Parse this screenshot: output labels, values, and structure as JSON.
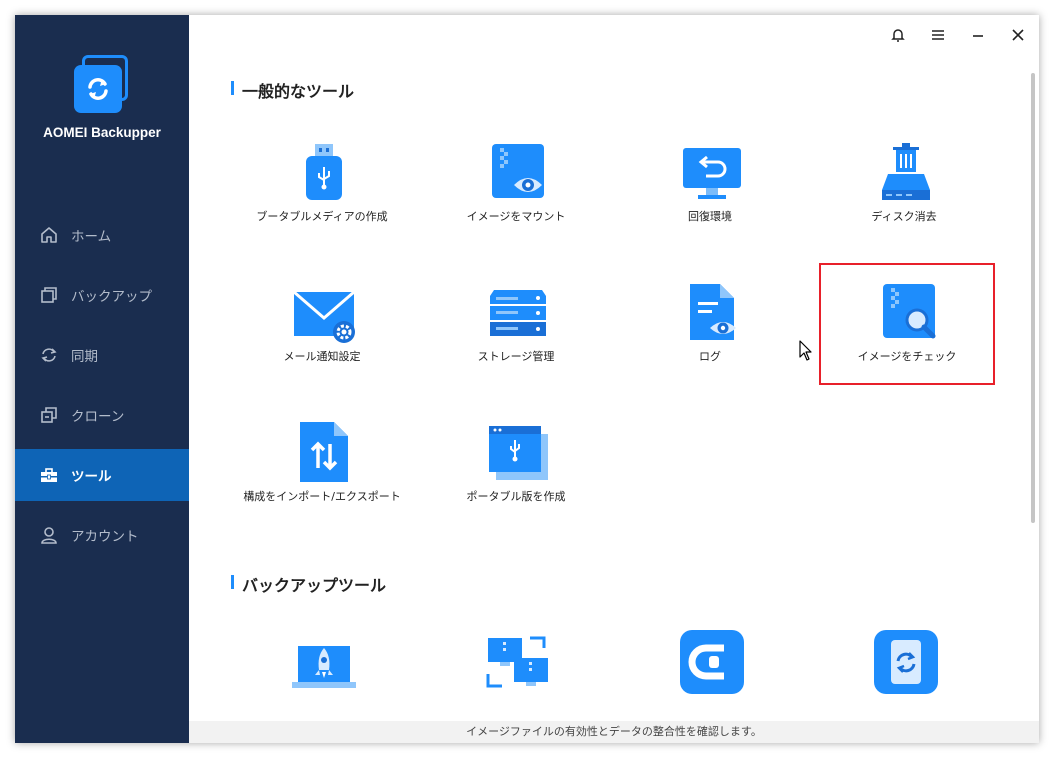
{
  "app": {
    "name": "AOMEI Backupper"
  },
  "sidebar": {
    "items": [
      {
        "label": "ホーム",
        "icon": "home-icon",
        "active": false
      },
      {
        "label": "バックアップ",
        "icon": "backup-icon",
        "active": false
      },
      {
        "label": "同期",
        "icon": "sync-icon",
        "active": false
      },
      {
        "label": "クローン",
        "icon": "clone-icon",
        "active": false
      },
      {
        "label": "ツール",
        "icon": "toolbox-icon",
        "active": true
      },
      {
        "label": "アカウント",
        "icon": "user-icon",
        "active": false
      }
    ]
  },
  "topbar": {
    "icons": [
      "bell-icon",
      "menu-icon",
      "minimize-icon",
      "close-icon"
    ]
  },
  "sections": {
    "common": {
      "title": "一般的なツール",
      "tools": [
        {
          "label": "ブータブルメディアの作成",
          "icon": "usb-drive-icon"
        },
        {
          "label": "イメージをマウント",
          "icon": "mount-image-icon"
        },
        {
          "label": "回復環境",
          "icon": "recovery-env-icon"
        },
        {
          "label": "ディスク消去",
          "icon": "disk-wipe-icon"
        },
        {
          "label": "メール通知設定",
          "icon": "email-settings-icon"
        },
        {
          "label": "ストレージ管理",
          "icon": "storage-manager-icon"
        },
        {
          "label": "ログ",
          "icon": "log-icon"
        },
        {
          "label": "イメージをチェック",
          "icon": "check-image-icon",
          "highlighted": true
        },
        {
          "label": "構成をインポート/エクスポート",
          "icon": "import-export-icon"
        },
        {
          "label": "ポータブル版を作成",
          "icon": "portable-version-icon"
        }
      ]
    },
    "backup": {
      "title": "バックアップツール",
      "tools": [
        {
          "label": "",
          "icon": "rocket-laptop-icon"
        },
        {
          "label": "",
          "icon": "pc-transfer-icon"
        },
        {
          "label": "",
          "icon": "centralized-c-icon"
        },
        {
          "label": "",
          "icon": "phone-sync-icon"
        }
      ]
    }
  },
  "status_bar": {
    "text": "イメージファイルの有効性とデータの整合性を確認します。"
  },
  "colors": {
    "sidebar_bg": "#1a2d4f",
    "accent": "#1e8dfc",
    "active_nav": "#0e64b6",
    "highlight": "#e8202a"
  }
}
